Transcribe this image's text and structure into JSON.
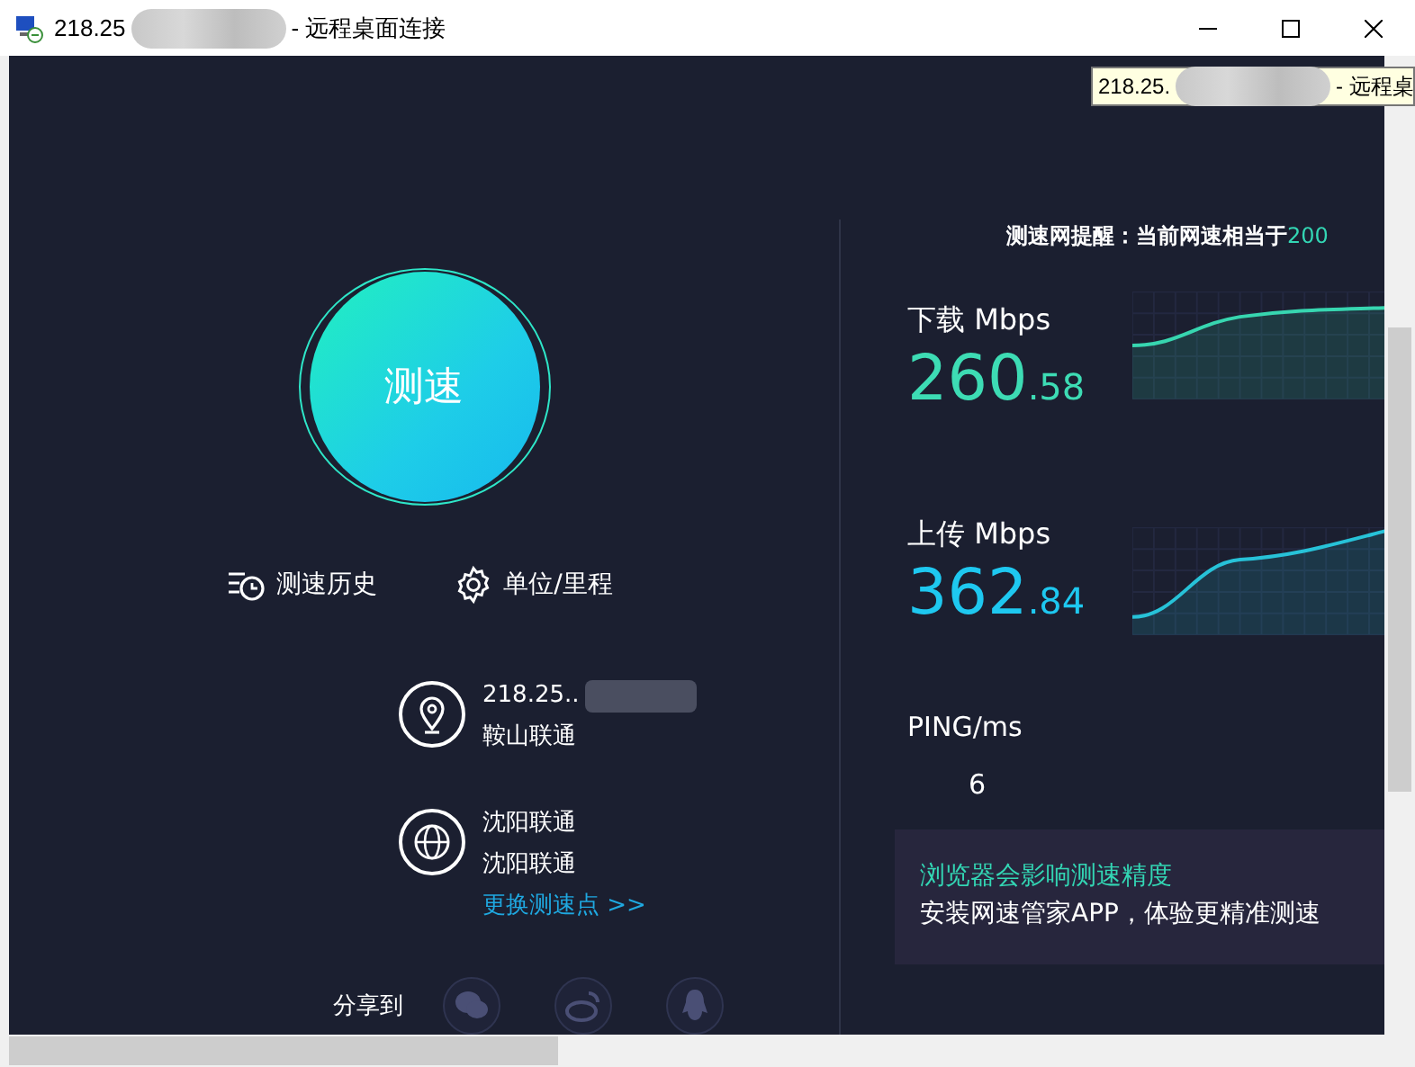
{
  "window": {
    "title_prefix": "218.25",
    "title_suffix": "- 远程桌面连接"
  },
  "tooltip": {
    "prefix": "218.25.",
    "suffix": "- 远程桌"
  },
  "speed_button": {
    "label": "测速"
  },
  "links": [
    {
      "kind": "history",
      "label": "测速历史"
    },
    {
      "kind": "settings",
      "label": "单位/里程"
    }
  ],
  "client": {
    "ip": "218.25..",
    "isp": "鞍山联通"
  },
  "server": {
    "name": "沈阳联通",
    "isp": "沈阳联通",
    "change_link": "更换测速点 >>"
  },
  "share": {
    "label": "分享到",
    "targets": [
      {
        "kind": "chat"
      },
      {
        "kind": "weibo"
      },
      {
        "kind": "penguin"
      }
    ]
  },
  "notice": {
    "text": "测速网提醒：当前网速相当于",
    "highlight": "200"
  },
  "metrics": [
    {
      "kind": "download",
      "label": "下载 Mbps",
      "whole": "260",
      "fraction": ".58"
    },
    {
      "kind": "upload",
      "label": "上传 Mbps",
      "whole": "362",
      "fraction": ".84"
    }
  ],
  "ping": {
    "label": "PING/ms",
    "value": "6"
  },
  "banner": {
    "title": "浏览器会影响测速精度",
    "text": "安装网速管家APP，体验更精准测速"
  }
}
